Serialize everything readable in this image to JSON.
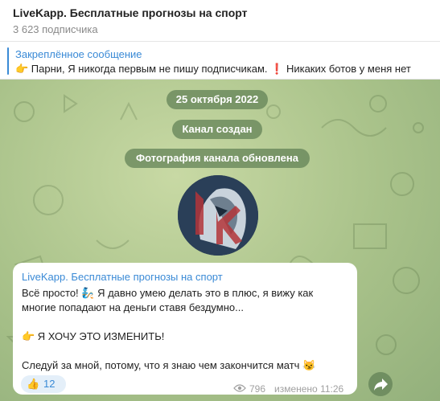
{
  "header": {
    "title": "LiveKapp. Бесплатные прогнозы на спорт",
    "subscribers": "3 623 подписчика"
  },
  "pinned": {
    "title": "Закреплённое сообщение",
    "text": "👉 Парни, Я никогда первым не пишу подписчикам. ❗ Никаких ботов у меня нет"
  },
  "service": {
    "date": "25 октября 2022",
    "created": "Канал создан",
    "photo_updated": "Фотография канала обновлена"
  },
  "message": {
    "author": "LiveKapp. Бесплатные прогнозы на спорт",
    "line1": "Всё просто! 🧞 Я давно умею делать это в плюс, я вижу как",
    "line2": "многие попадают на деньги ставя бездумно...",
    "line3": "👉 Я ХОЧУ ЭТО ИЗМЕНИТЬ!",
    "line4": "Следуй за мной, потому, что я знаю чем закончится матч 😼",
    "reaction_emoji": "👍",
    "reaction_count": "12",
    "views": "796",
    "edited": "изменено 11:26"
  },
  "colors": {
    "accent": "#3a8ad6",
    "chat_bg": "#a9c28a",
    "pill_bg": "#6a8a5a"
  }
}
